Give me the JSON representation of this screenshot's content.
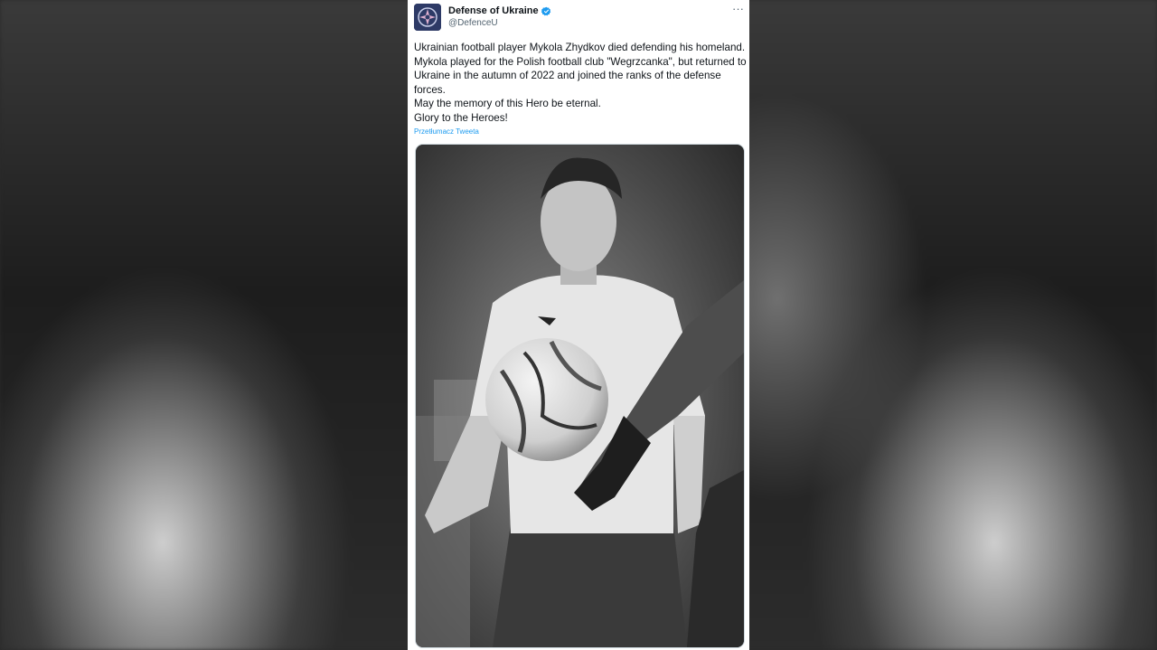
{
  "tweet": {
    "author_name": "Defense of Ukraine",
    "handle": "@DefenceU",
    "verified": true,
    "more_icon": "more-icon",
    "text_lines": [
      "Ukrainian football player Mykola Zhydkov died defending his homeland.",
      "Mykola played for the Polish football club \"Wegrzcanka\", but returned to Ukraine in the autumn of 2022 and joined the ranks of the defense forces.",
      "May the memory of this Hero be eternal.",
      "Glory to the Heroes!"
    ],
    "translate_link": "Przetłumacz Tweeta"
  },
  "colors": {
    "link": "#1d9bf0",
    "text": "#0f1419",
    "secondary": "#536471",
    "avatar_bg": "#2d3a66"
  }
}
